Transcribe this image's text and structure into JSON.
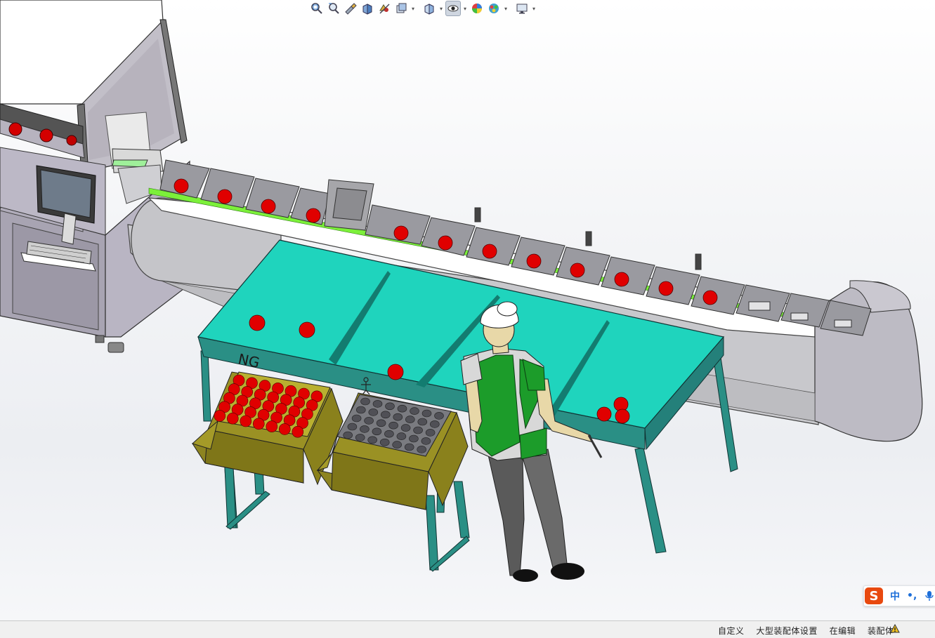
{
  "toolbar": {
    "buttons": [
      {
        "icon": "zoom-to-fit-icon",
        "dropdown": false
      },
      {
        "icon": "zoom-to-area-icon",
        "dropdown": false
      },
      {
        "icon": "previous-view-icon",
        "dropdown": false
      },
      {
        "icon": "section-view-icon",
        "dropdown": false
      },
      {
        "icon": "dynamic-annotation-views-icon",
        "dropdown": false
      },
      {
        "icon": "view-orientation-icon",
        "dropdown": true
      },
      {
        "icon": "display-style-icon",
        "dropdown": true
      },
      {
        "icon": "hide-show-items-icon",
        "dropdown": true,
        "active": true
      },
      {
        "icon": "edit-appearance-icon",
        "dropdown": false
      },
      {
        "icon": "apply-scene-icon",
        "dropdown": true
      },
      {
        "icon": "view-settings-icon",
        "dropdown": true
      }
    ]
  },
  "scene": {
    "table_marking": "NG",
    "colors": {
      "table_top": "#1fd4bd",
      "frame": "#2a8f85",
      "conveyor_belt": "#ffffff",
      "conveyor_side": "#c9c9cd",
      "bucket": "#9a9aa0",
      "guide_strip": "#7cf03a",
      "apple": "#e00000",
      "carton": "#8d8420",
      "machine_frame": "#a9a4b4",
      "shirt_green": "#1c9c2a",
      "trousers": "#555555"
    }
  },
  "status_bar": {
    "text": "自定义 　大型装配体设置 　在编辑 　装配体",
    "icon": "rebuild-indicator-icon"
  },
  "ime": {
    "logo": "S",
    "mode": "中",
    "punct": "•,",
    "mic_icon": "microphone-icon"
  }
}
